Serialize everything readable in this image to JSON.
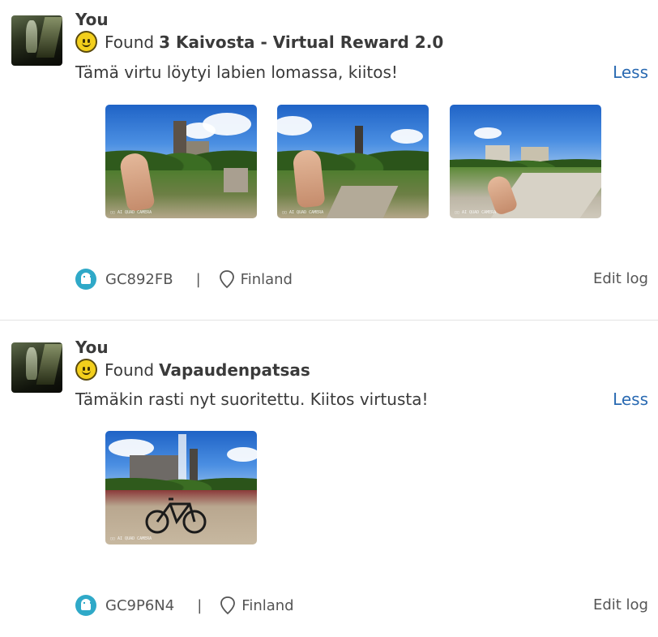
{
  "logs": [
    {
      "user": "You",
      "log_type": "Found",
      "cache_name": "3 Kaivosta - Virtual Reward 2.0",
      "text": "Tämä virtu löytyi labien lomassa, kiitos!",
      "toggle_label": "Less",
      "photo_count": 3,
      "cache_code": "GC892FB",
      "separator": "|",
      "location": "Finland",
      "edit_label": "Edit log"
    },
    {
      "user": "You",
      "log_type": "Found",
      "cache_name": "Vapaudenpatsas",
      "text": "Tämäkin rasti nyt suoritettu. Kiitos virtusta!",
      "toggle_label": "Less",
      "photo_count": 1,
      "cache_code": "GC9P6N4",
      "separator": "|",
      "location": "Finland",
      "edit_label": "Edit log"
    }
  ],
  "icons": {
    "log_type": "smiley-found-icon",
    "cache_type": "ghost-virtual-cache-icon",
    "location": "map-pin-icon"
  },
  "colors": {
    "link": "#2a6ab2",
    "cache_type_badge": "#2fa9c8",
    "smiley": "#f3cf1c"
  }
}
